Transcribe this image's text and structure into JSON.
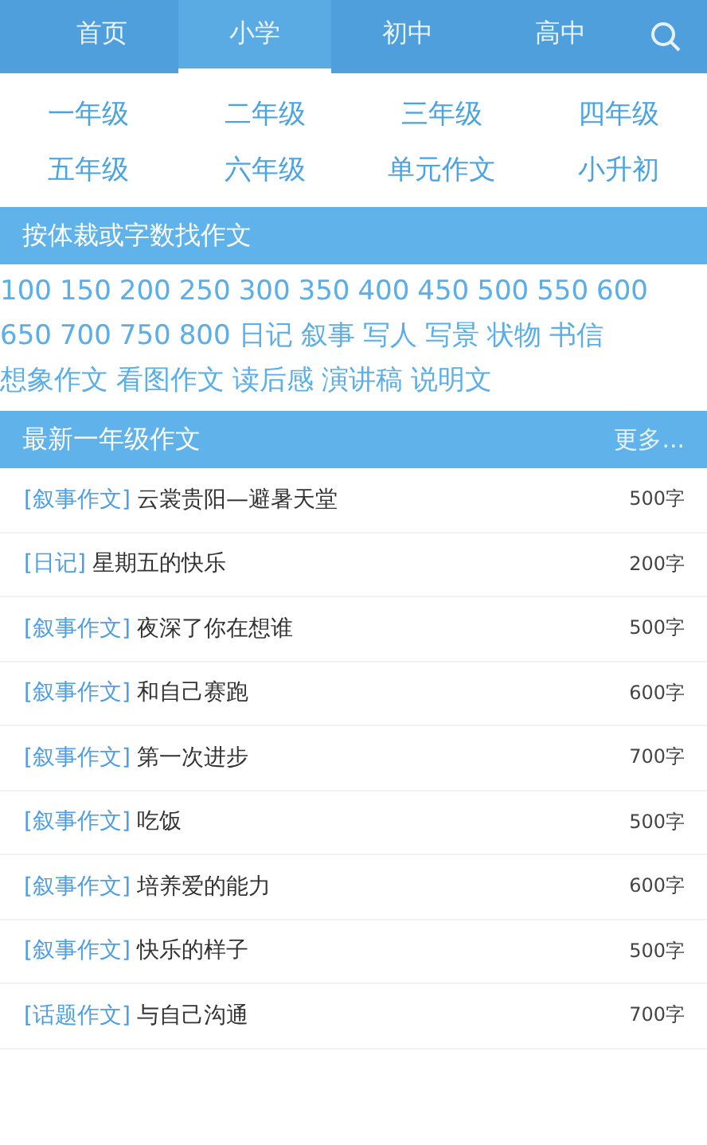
{
  "nav": {
    "tabs": [
      {
        "label": "首页",
        "selected": false
      },
      {
        "label": "小学",
        "selected": true
      },
      {
        "label": "初中",
        "selected": false
      },
      {
        "label": "高中",
        "selected": false
      }
    ]
  },
  "grades": [
    "一年级",
    "二年级",
    "三年级",
    "四年级",
    "五年级",
    "六年级",
    "单元作文",
    "小升初"
  ],
  "filter": {
    "title": "按体裁或字数找作文",
    "word_counts": [
      "100",
      "150",
      "200",
      "250",
      "300",
      "350",
      "400",
      "450",
      "500",
      "550",
      "600",
      "650",
      "700",
      "750",
      "800"
    ],
    "genres": [
      "日记",
      "叙事",
      "写人",
      "写景",
      "状物",
      "书信",
      "想象作文",
      "看图作文",
      "读后感",
      "演讲稿",
      "说明文"
    ]
  },
  "latest": {
    "title": "最新一年级作文",
    "more": "更多...",
    "rows": [
      {
        "tag": "[叙事作文]",
        "title": "云裳贵阳—避暑天堂",
        "count": "500字"
      },
      {
        "tag": "[日记]",
        "title": "星期五的快乐",
        "count": "200字"
      },
      {
        "tag": "[叙事作文]",
        "title": "夜深了你在想谁",
        "count": "500字"
      },
      {
        "tag": "[叙事作文]",
        "title": "和自己赛跑",
        "count": "600字"
      },
      {
        "tag": "[叙事作文]",
        "title": "第一次进步",
        "count": "700字"
      },
      {
        "tag": "[叙事作文]",
        "title": "吃饭",
        "count": "500字"
      },
      {
        "tag": "[叙事作文]",
        "title": "培养爱的能力",
        "count": "600字"
      },
      {
        "tag": "[叙事作文]",
        "title": "快乐的样子",
        "count": "500字"
      },
      {
        "tag": "[话题作文]",
        "title": "与自己沟通",
        "count": "700字"
      }
    ]
  }
}
